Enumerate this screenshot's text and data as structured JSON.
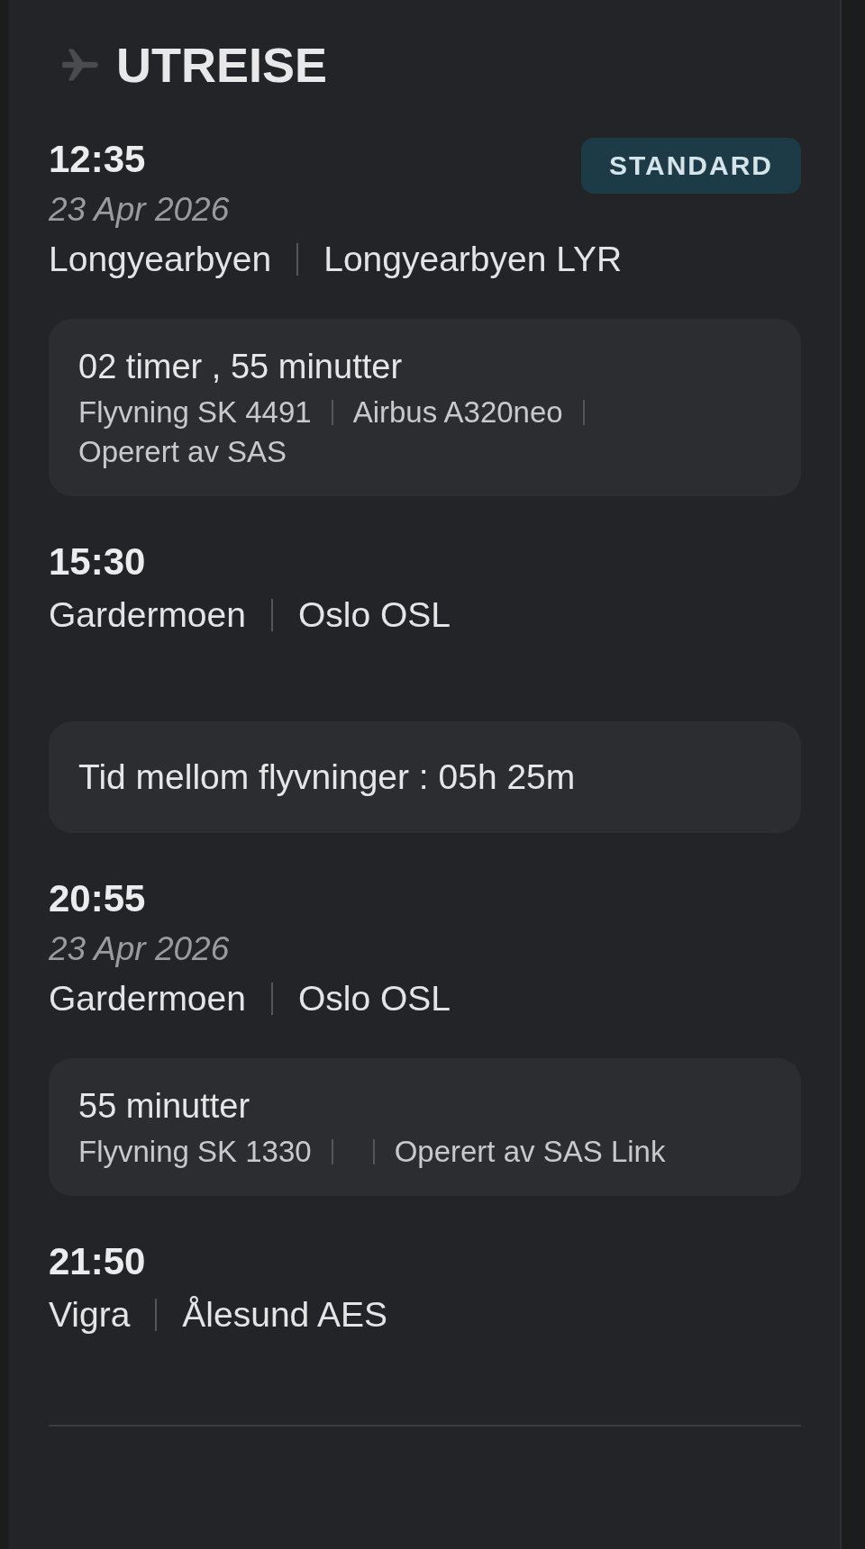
{
  "section": {
    "title": "UTREISE"
  },
  "items": [
    {
      "kind": "stop",
      "time": "12:35",
      "badge": "STANDARD",
      "date": "23 Apr 2026",
      "place": "Longyearbyen",
      "airport": "Longyearbyen LYR"
    },
    {
      "kind": "flight",
      "duration": "02 timer , 55 minutter",
      "flight": "Flyvning SK 4491",
      "aircraft": "Airbus A320neo",
      "operator": "Operert av SAS"
    },
    {
      "kind": "stop",
      "time": "15:30",
      "place": "Gardermoen",
      "airport": "Oslo OSL"
    },
    {
      "kind": "layover",
      "text": "Tid mellom flyvninger : 05h 25m"
    },
    {
      "kind": "stop",
      "time": "20:55",
      "date": "23 Apr 2026",
      "place": "Gardermoen",
      "airport": "Oslo OSL"
    },
    {
      "kind": "flight",
      "duration": "55 minutter",
      "flight": "Flyvning SK 1330",
      "operator": "Operert av SAS Link"
    },
    {
      "kind": "stop",
      "time": "21:50",
      "place": "Vigra",
      "airport": "Ålesund AES"
    }
  ]
}
